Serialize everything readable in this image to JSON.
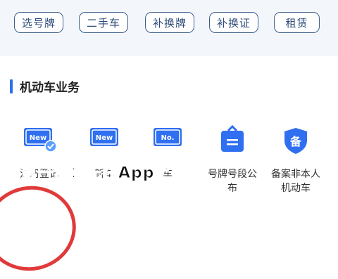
{
  "quick_buttons": [
    "选号牌",
    "二手车",
    "补换牌",
    "补换证",
    "租赁"
  ],
  "section": {
    "title": "机动车业务"
  },
  "tiles": [
    {
      "label": "注册登记",
      "icon": "new-plate-check-icon"
    },
    {
      "label": "新车",
      "icon": "new-plate-icon"
    },
    {
      "label": "车",
      "icon": "number-plate-icon"
    },
    {
      "label": "号牌号段公布",
      "icon": "plate-sign-icon"
    },
    {
      "label": "备案非本人机动车",
      "icon": "backup-shield-icon"
    }
  ],
  "overlay": {
    "text": "第一步：先在App上申请"
  },
  "colors": {
    "accent": "#2f6ff0",
    "button_border": "#3e5f8d",
    "marker": "#e03a3a"
  }
}
